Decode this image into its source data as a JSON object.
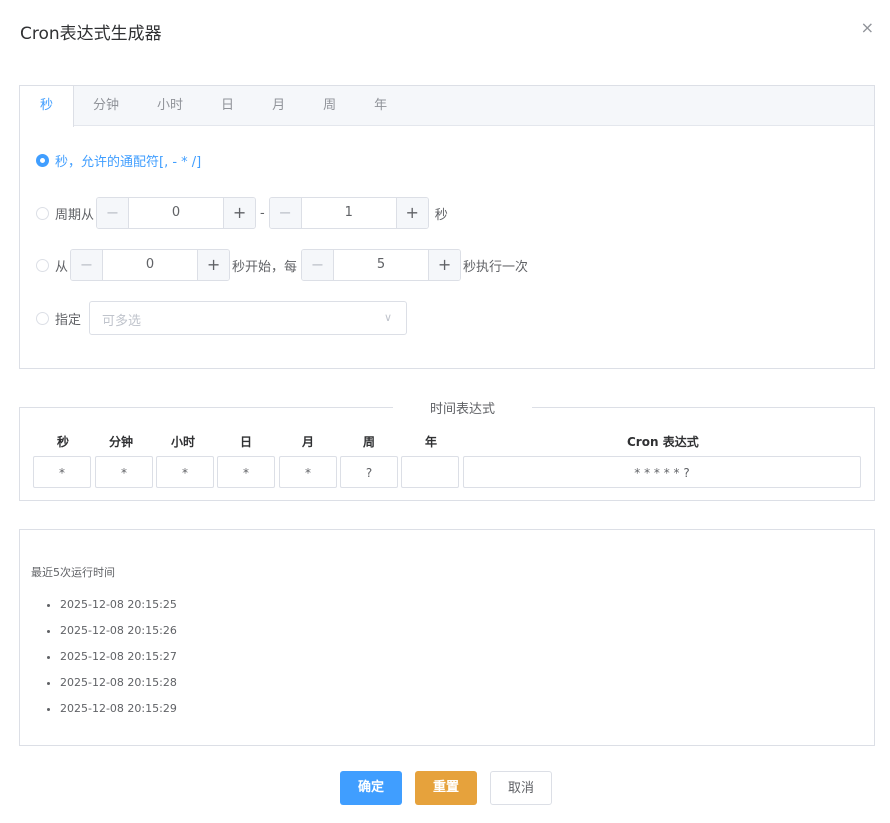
{
  "dialog": {
    "title": "Cron表达式生成器",
    "close": "×"
  },
  "tabs": [
    {
      "label": "秒"
    },
    {
      "label": "分钟"
    },
    {
      "label": "小时"
    },
    {
      "label": "日"
    },
    {
      "label": "月"
    },
    {
      "label": "周"
    },
    {
      "label": "年"
    }
  ],
  "options": {
    "wildcard": "秒，允许的通配符[, - * /]",
    "cycle": {
      "prefix": "周期从",
      "from": "0",
      "dash": "-",
      "to": "1",
      "suffix": "秒"
    },
    "loop": {
      "prefix": "从",
      "start": "0",
      "middle": "秒开始，每",
      "step": "5",
      "suffix": "秒执行一次"
    },
    "specify": {
      "label": "指定",
      "placeholder": "可多选"
    }
  },
  "stepper": {
    "minus": "−",
    "plus": "+"
  },
  "expression": {
    "legend": "时间表达式",
    "headers": [
      "秒",
      "分钟",
      "小时",
      "日",
      "月",
      "周",
      "年",
      "Cron 表达式"
    ],
    "values": [
      "*",
      "*",
      "*",
      "*",
      "*",
      "?",
      "",
      "* * * * * ?"
    ]
  },
  "runs": {
    "title": "最近5次运行时间",
    "items": [
      "2025-12-08 20:15:25",
      "2025-12-08 20:15:26",
      "2025-12-08 20:15:27",
      "2025-12-08 20:15:28",
      "2025-12-08 20:15:29"
    ]
  },
  "footer": {
    "ok": "确定",
    "reset": "重置",
    "cancel": "取消"
  },
  "colors": {
    "primary": "#409eff",
    "warning": "#e6a23c",
    "border": "#dcdfe6"
  }
}
